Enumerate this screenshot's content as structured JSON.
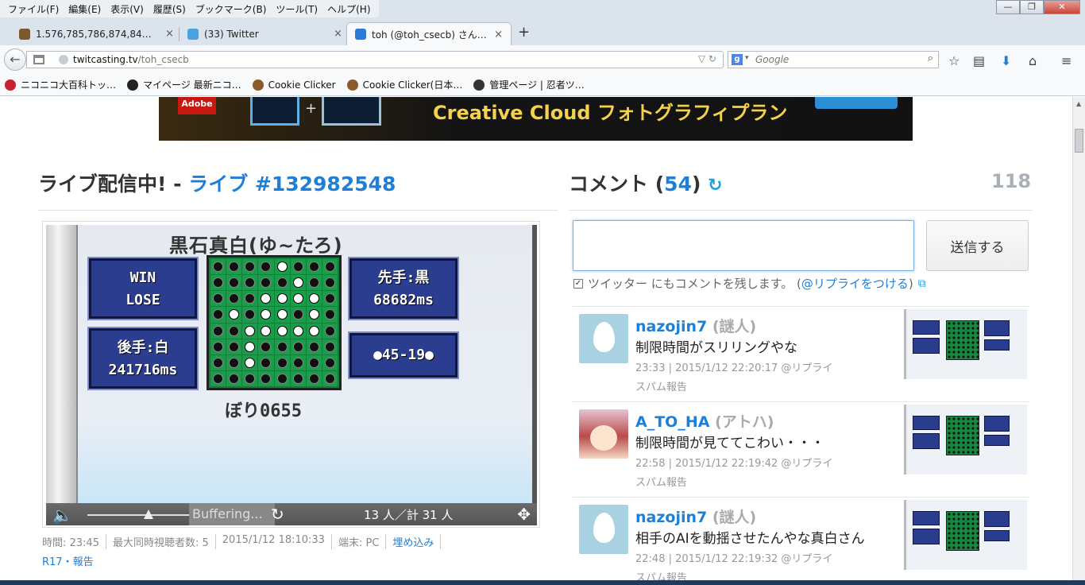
{
  "menubar": {
    "items": [
      "ファイル(F)",
      "編集(E)",
      "表示(V)",
      "履歴(S)",
      "ブックマーク(B)",
      "ツール(T)",
      "ヘルプ(H)"
    ],
    "window_buttons": {
      "minimize": "—",
      "maximize": "❐",
      "close": "✕"
    }
  },
  "tabs": [
    {
      "label": "1.576,785,786,874,84…",
      "favicon_color": "#7a5a2e",
      "active": false
    },
    {
      "label": "(33) Twitter",
      "favicon_color": "#4aa3df",
      "active": false
    },
    {
      "label": "toh (@toh_csecb) さん…",
      "favicon_color": "#2a7bd8",
      "active": true
    }
  ],
  "tab_close": "×",
  "new_tab": "+",
  "nav": {
    "url_host": "twitcasting.tv",
    "url_path": "/toh_csecb",
    "search_placeholder": "Google",
    "back_icon": "←",
    "url_arrows": "▽ ↻",
    "search_engine_letter": "g",
    "search_drop": "▾",
    "search_icon": "⌕",
    "toolbar_icons": [
      "☆",
      "▤",
      "⬇",
      "⌂",
      "≡"
    ]
  },
  "bookmarks": [
    {
      "label": "ニコニコ大百科トッ…",
      "icon_color": "#c8202c"
    },
    {
      "label": "マイページ 最新ニコ…",
      "icon_color": "#222"
    },
    {
      "label": "Cookie Clicker",
      "icon_color": "#8a5a2a"
    },
    {
      "label": "Cookie Clicker(日本…",
      "icon_color": "#8a5a2a"
    },
    {
      "label": "管理ページ | 忍者ツ…",
      "icon_color": "#333"
    }
  ],
  "ad": {
    "brand": "Adobe",
    "text": "Creative Cloud フォトグラフィプラン",
    "plus": "+"
  },
  "live": {
    "title_prefix": "ライブ配信中! - ",
    "title_link": "ライブ #132982548"
  },
  "player": {
    "game_title": "黒石真白(ゆ~たろ)",
    "panel_win_lose": [
      "WIN",
      "LOSE"
    ],
    "panel_first": [
      "先手:黒",
      "68682ms"
    ],
    "panel_second": [
      "後手:白",
      "241716ms"
    ],
    "panel_score": "●45-19●",
    "bottom_name": "ぼり0655",
    "board": [
      "bbbbwbbb",
      "bbbbbwbb",
      "bbbwwwwb",
      "bwbwwbwb",
      "bbwwwwwb",
      "bbwbbbbb",
      "bbwbbbbb",
      "bbbbbbbb"
    ],
    "buffering": "Buffering...",
    "viewers": "13 人／計 31 人",
    "speaker_icon": "🔈",
    "reload_icon": "↻",
    "fullscreen_icon": "✥",
    "volume": 0.6
  },
  "meta": {
    "time": "時間: 23:45",
    "max_viewers": "最大同時視聴者数: 5",
    "date": "2015/1/12 18:10:33",
    "device": "端末: PC",
    "embed": "埋め込み",
    "report": "R17・報告"
  },
  "comments": {
    "title": "コメント",
    "count_open": "(",
    "count": "54",
    "count_close": ")",
    "reload_icon": "↻",
    "total": "118",
    "input_value": "",
    "send_label": "送信する",
    "twitter_check": "✓",
    "twitter_label": "ツイッター にもコメントを残します。 (",
    "reply_link": "@リプライをつける",
    "twitter_close": ")",
    "ext_icon": "⧉",
    "items": [
      {
        "name": "nazojin7",
        "nick": "(謎人)",
        "message": "制限時間がスリリングやな",
        "time": "23:33 | 2015/1/12 22:20:17 @リプライ",
        "spam": "スパム報告",
        "avatar": "egg"
      },
      {
        "name": "A_TO_HA",
        "nick": "(アトハ)",
        "message": "制限時間が見ててこわい・・・",
        "time": "22:58 | 2015/1/12 22:19:42 @リプライ",
        "spam": "スパム報告",
        "avatar": "anime"
      },
      {
        "name": "nazojin7",
        "nick": "(謎人)",
        "message": "相手のAIを動揺させたんやな真白さん",
        "time": "22:48 | 2015/1/12 22:19:32 @リプライ",
        "spam": "スパム報告",
        "avatar": "egg"
      }
    ]
  },
  "colors": {
    "link": "#1e7fd8",
    "board_green": "#1b9c4a",
    "panel_blue": "#2b3d8e"
  }
}
